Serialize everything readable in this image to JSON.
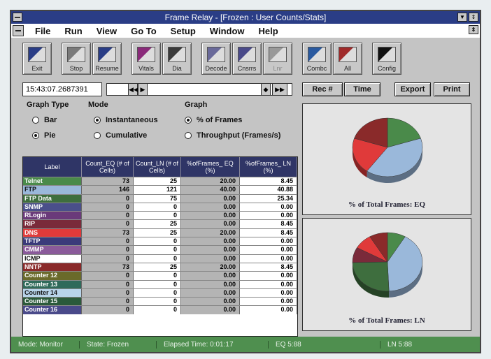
{
  "window": {
    "title": "Frame Relay - [Frozen : User Counts/Stats]"
  },
  "menu": [
    "File",
    "Run",
    "View",
    "Go To",
    "Setup",
    "Window",
    "Help"
  ],
  "toolbar": [
    {
      "label": "Exit",
      "icon": "exit-icon",
      "enabled": true
    },
    {
      "label": "Stop",
      "icon": "stop-icon",
      "enabled": true
    },
    {
      "label": "Resume",
      "icon": "resume-icon",
      "enabled": true
    },
    {
      "label": "Vitals",
      "icon": "vitals-icon",
      "enabled": true
    },
    {
      "label": "Dia",
      "icon": "dia-icon",
      "enabled": true
    },
    {
      "label": "Decode",
      "icon": "decode-icon",
      "enabled": true
    },
    {
      "label": "Cnsrrs",
      "icon": "cnsrrs-icon",
      "enabled": true
    },
    {
      "label": "Lnr",
      "icon": "lnr-icon",
      "enabled": false
    },
    {
      "label": "Combc",
      "icon": "combc-icon",
      "enabled": true
    },
    {
      "label": "All",
      "icon": "all-icon",
      "enabled": true
    },
    {
      "label": "Config",
      "icon": "config-icon",
      "enabled": true
    }
  ],
  "nav": {
    "timestamp": "15:43:07.2687391",
    "buttons": [
      "Rec #",
      "Time",
      "Export",
      "Print"
    ]
  },
  "options": {
    "graph_type_label": "Graph Type",
    "graph_type": [
      "Bar",
      "Pie"
    ],
    "graph_type_selected": "Pie",
    "mode_label": "Mode",
    "mode": [
      "Instantaneous",
      "Cumulative"
    ],
    "mode_selected": "Instantaneous",
    "graph_label": "Graph",
    "graph": [
      "% of Frames",
      "Throughput (Frames/s)"
    ],
    "graph_selected": "% of Frames"
  },
  "table": {
    "headers": [
      "Label",
      "Count_EQ\n(# of Cells)",
      "Count_LN\n(# of Cells)",
      "%ofFrames_\nEQ (%)",
      "%ofFrames_\nLN (%)"
    ],
    "rows": [
      {
        "label": "Telnet",
        "color": "#4a8a4a",
        "eq": "73",
        "ln": "25",
        "peq": "20.00",
        "pln": "8.45"
      },
      {
        "label": "FTP",
        "color": "#9ab8da",
        "eq": "146",
        "ln": "121",
        "peq": "40.00",
        "pln": "40.88"
      },
      {
        "label": "FTP Data",
        "color": "#3e6e3e",
        "eq": "0",
        "ln": "75",
        "peq": "0.00",
        "pln": "25.34"
      },
      {
        "label": "SNMP",
        "color": "#4a4f8a",
        "eq": "0",
        "ln": "0",
        "peq": "0.00",
        "pln": "0.00"
      },
      {
        "label": "RLogin",
        "color": "#6a3a7a",
        "eq": "0",
        "ln": "0",
        "peq": "0.00",
        "pln": "0.00"
      },
      {
        "label": "RIP",
        "color": "#7a2a3a",
        "eq": "0",
        "ln": "25",
        "peq": "0.00",
        "pln": "8.45"
      },
      {
        "label": "DNS",
        "color": "#e03a3a",
        "eq": "73",
        "ln": "25",
        "peq": "20.00",
        "pln": "8.45"
      },
      {
        "label": "TFTP",
        "color": "#3a3a7a",
        "eq": "0",
        "ln": "0",
        "peq": "0.00",
        "pln": "0.00"
      },
      {
        "label": "CMMP",
        "color": "#8a5a9a",
        "eq": "0",
        "ln": "0",
        "peq": "0.00",
        "pln": "0.00"
      },
      {
        "label": "ICMP",
        "color": "#ffffff",
        "eq": "0",
        "ln": "0",
        "peq": "0.00",
        "pln": "0.00"
      },
      {
        "label": "NNTP",
        "color": "#8a2a2a",
        "eq": "73",
        "ln": "25",
        "peq": "20.00",
        "pln": "8.45"
      },
      {
        "label": "Counter 12",
        "color": "#6a6a2a",
        "eq": "0",
        "ln": "0",
        "peq": "0.00",
        "pln": "0.00"
      },
      {
        "label": "Counter 13",
        "color": "#2f6a5a",
        "eq": "0",
        "ln": "0",
        "peq": "0.00",
        "pln": "0.00"
      },
      {
        "label": "Counter 14",
        "color": "#b8d4ea",
        "eq": "0",
        "ln": "0",
        "peq": "0.00",
        "pln": "0.00"
      },
      {
        "label": "Counter 15",
        "color": "#2a5a3a",
        "eq": "0",
        "ln": "0",
        "peq": "0.00",
        "pln": "0.00"
      },
      {
        "label": "Counter 16",
        "color": "#4a4a8a",
        "eq": "0",
        "ln": "0",
        "peq": "0.00",
        "pln": "0.00"
      }
    ]
  },
  "chart_data": [
    {
      "type": "pie",
      "title": "% of Total Frames: EQ",
      "categories": [
        "Telnet",
        "FTP",
        "DNS",
        "NNTP"
      ],
      "values": [
        20,
        40,
        20,
        20
      ],
      "colors": [
        "#4a8a4a",
        "#9ab8da",
        "#e03a3a",
        "#8a2a2a"
      ]
    },
    {
      "type": "pie",
      "title": "% of Total Frames: LN",
      "categories": [
        "Telnet",
        "FTP",
        "FTP Data",
        "RIP",
        "DNS",
        "NNTP"
      ],
      "values": [
        8.45,
        40.88,
        25.34,
        8.45,
        8.45,
        8.45
      ],
      "colors": [
        "#4a8a4a",
        "#9ab8da",
        "#3e6e3e",
        "#7a2a3a",
        "#e03a3a",
        "#8a2a2a"
      ]
    }
  ],
  "status": {
    "mode": "Mode: Monitor",
    "state": "State: Frozen",
    "elapsed": "Elapsed Time: 0:01:17",
    "eq": "EQ 5:88",
    "ln": "LN 5:88"
  }
}
